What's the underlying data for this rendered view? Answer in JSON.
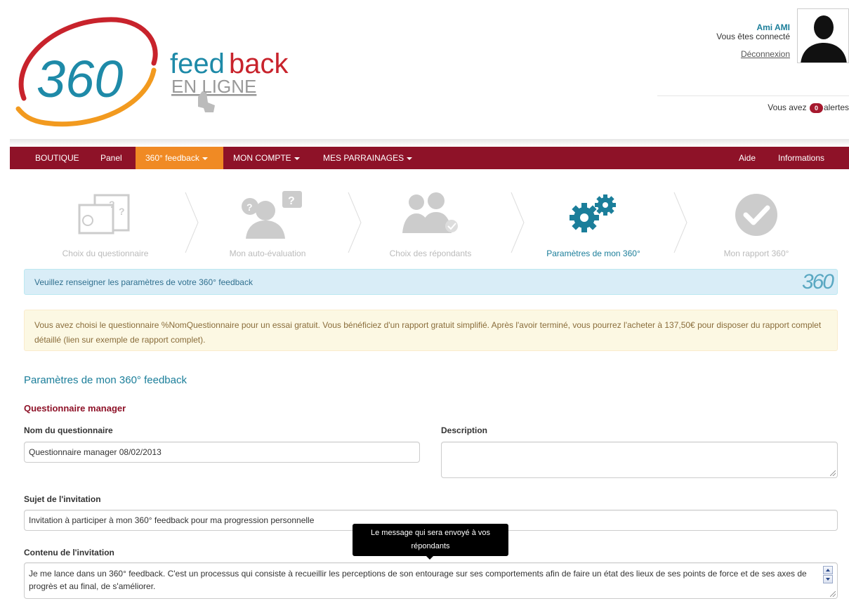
{
  "header": {
    "logo": {
      "number": "360",
      "word_feed": "feed",
      "word_back": "back",
      "tagline": "EN LIGNE"
    },
    "user": {
      "name": "Ami AMI",
      "status": "Vous êtes connecté",
      "logout": "Déconnexion"
    },
    "alerts": {
      "prefix": "Vous avez",
      "count": "0",
      "suffix": "alertes"
    }
  },
  "navbar": {
    "items": [
      {
        "label": "BOUTIQUE"
      },
      {
        "label": "Panel"
      },
      {
        "label": "360° feedback"
      },
      {
        "label": "MON COMPTE"
      },
      {
        "label": "MES PARRAINAGES"
      }
    ],
    "right_items": [
      {
        "label": "Aide"
      },
      {
        "label": "Informations"
      }
    ],
    "colors": {
      "bar": "#8e1228",
      "active": "#f08a24"
    }
  },
  "steps": [
    {
      "label": "Choix du questionnaire",
      "icon": "questionnaire-icon"
    },
    {
      "label": "Mon auto-évaluation",
      "icon": "self-evaluation-icon"
    },
    {
      "label": "Choix des répondants",
      "icon": "respondents-icon"
    },
    {
      "label": "Paramètres de mon 360°",
      "icon": "gears-icon"
    },
    {
      "label": "Mon rapport 360°",
      "icon": "checkmark-icon"
    }
  ],
  "info_message": {
    "text": "Veuillez renseigner les paramètres de votre 360° feedback",
    "badge": "360"
  },
  "warning_message": "Vous avez choisi le questionnaire %NomQuestionnaire pour un essai gratuit. Vous bénéficiez d'un rapport gratuit simplifié. Après l'avoir terminé, vous pourrez l'acheter à 137,50€ pour disposer du rapport complet détaillé (lien sur exemple de rapport complet).",
  "form": {
    "section_title": "Paramètres de mon 360° feedback",
    "subsection_title": "Questionnaire manager",
    "name_label": "Nom du questionnaire",
    "name_value": "Questionnaire manager 08/02/2013",
    "description_label": "Description",
    "description_value": "",
    "subject_label": "Sujet de l'invitation",
    "subject_value": "Invitation à participer à mon 360° feedback pour ma progression personnelle",
    "content_label": "Contenu de l'invitation",
    "content_value": "Je me lance dans un 360° feedback. C'est un processus qui consiste à recueillir les perceptions de son entourage sur ses comportements afin de faire un état des lieux de ses points de force et de ses axes de progrès et au final, de s'améliorer.",
    "tooltip": "Le message qui sera envoyé à vos répondants"
  }
}
